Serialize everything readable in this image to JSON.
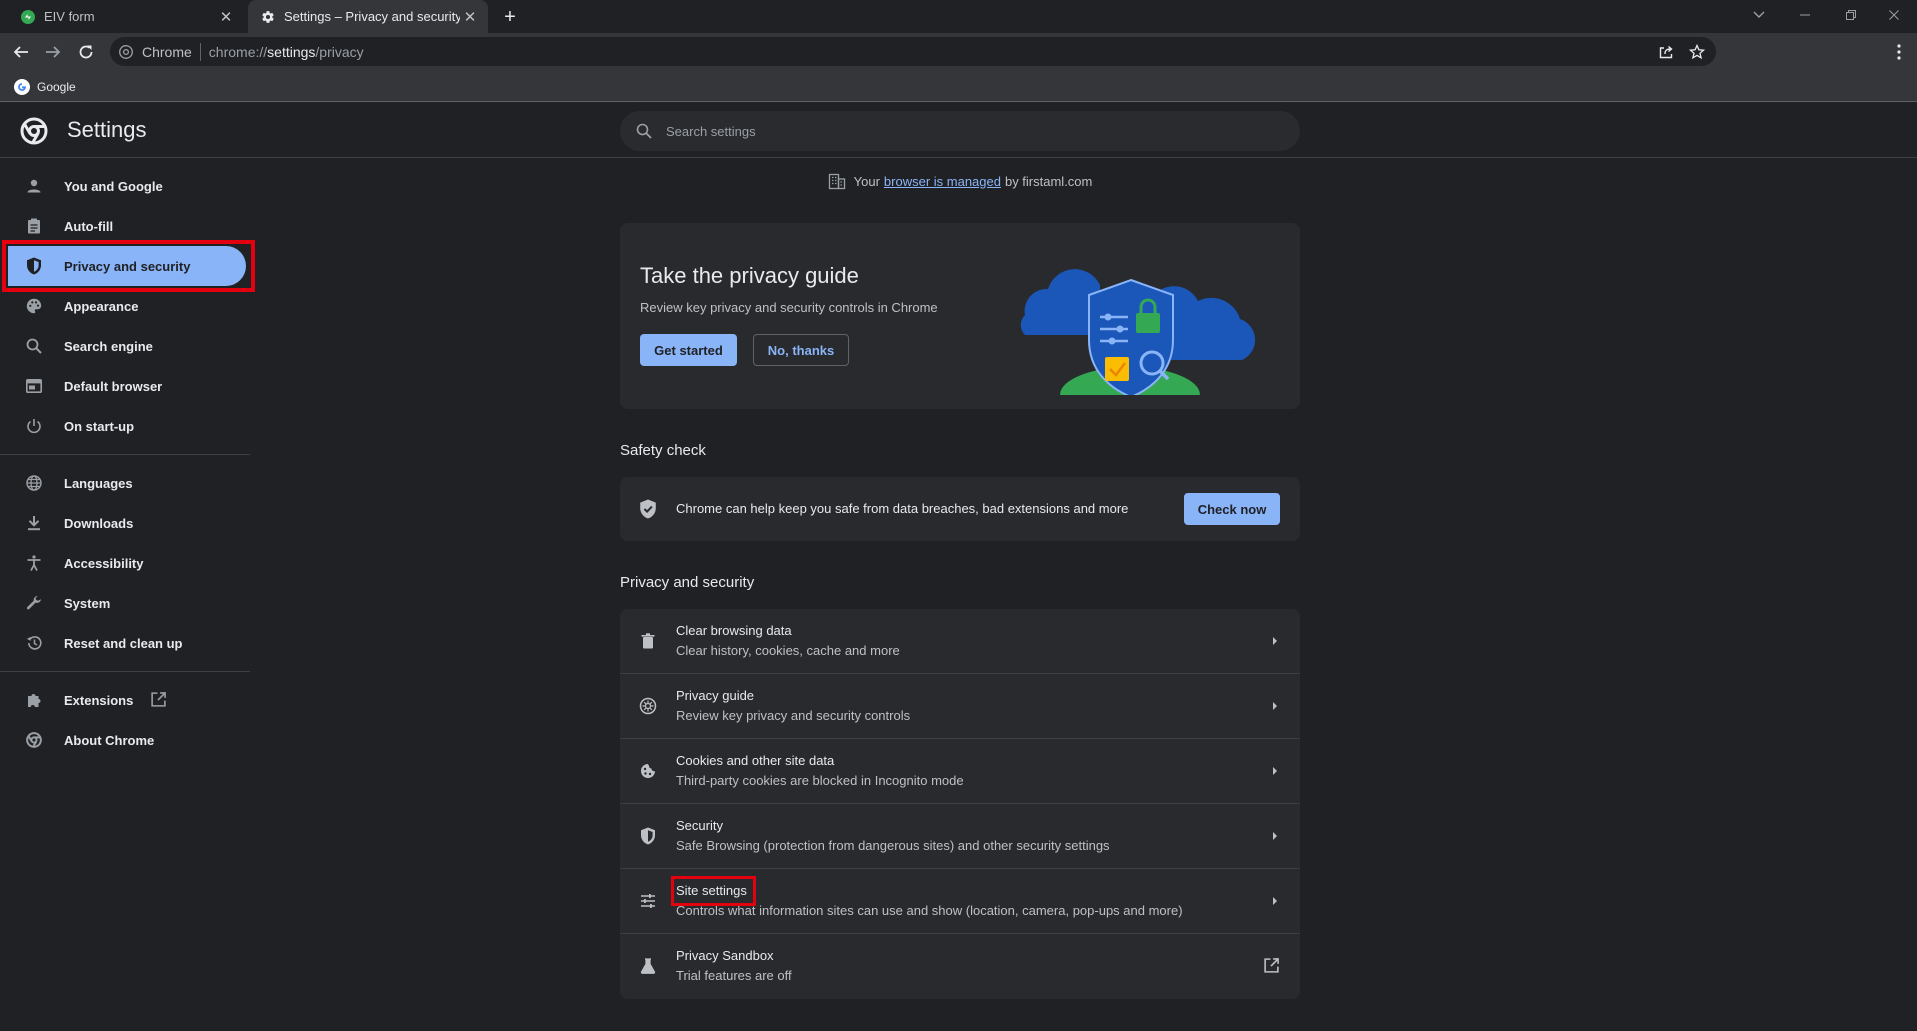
{
  "tabs": [
    {
      "title": "EIV form",
      "active": false
    },
    {
      "title": "Settings – Privacy and security",
      "active": true
    }
  ],
  "toolbar": {
    "origin": "Chrome",
    "url_scheme": "chrome://",
    "url_host": "settings",
    "url_path": "/privacy"
  },
  "bookmarks": [
    {
      "label": "Google"
    }
  ],
  "settings": {
    "title": "Settings",
    "search_placeholder": "Search settings"
  },
  "sidebar": {
    "items": [
      {
        "label": "You and Google",
        "icon": "person-icon"
      },
      {
        "label": "Auto-fill",
        "icon": "clipboard-icon"
      },
      {
        "label": "Privacy and security",
        "icon": "shield-icon",
        "active": true
      },
      {
        "label": "Appearance",
        "icon": "palette-icon"
      },
      {
        "label": "Search engine",
        "icon": "search-icon"
      },
      {
        "label": "Default browser",
        "icon": "browser-icon"
      },
      {
        "label": "On start-up",
        "icon": "power-icon"
      },
      {
        "label": "Languages",
        "icon": "globe-icon"
      },
      {
        "label": "Downloads",
        "icon": "download-icon"
      },
      {
        "label": "Accessibility",
        "icon": "accessibility-icon"
      },
      {
        "label": "System",
        "icon": "wrench-icon"
      },
      {
        "label": "Reset and clean up",
        "icon": "history-icon"
      },
      {
        "label": "Extensions",
        "icon": "puzzle-icon"
      },
      {
        "label": "About Chrome",
        "icon": "chrome-icon"
      }
    ]
  },
  "managed": {
    "prefix": "Your",
    "link": "browser is managed",
    "suffix": "by firstaml.com"
  },
  "privacy_guide": {
    "title": "Take the privacy guide",
    "subtitle": "Review key privacy and security controls in Chrome",
    "primary_label": "Get started",
    "secondary_label": "No, thanks"
  },
  "safety_check": {
    "section_title": "Safety check",
    "text": "Chrome can help keep you safe from data breaches, bad extensions and more",
    "button_label": "Check now"
  },
  "privacy_section": {
    "section_title": "Privacy and security",
    "rows": [
      {
        "title": "Clear browsing data",
        "subtitle": "Clear history, cookies, cache and more",
        "icon": "trash-icon"
      },
      {
        "title": "Privacy guide",
        "subtitle": "Review key privacy and security controls",
        "icon": "compass-icon"
      },
      {
        "title": "Cookies and other site data",
        "subtitle": "Third-party cookies are blocked in Incognito mode",
        "icon": "cookie-icon"
      },
      {
        "title": "Security",
        "subtitle": "Safe Browsing (protection from dangerous sites) and other security settings",
        "icon": "shield-icon"
      },
      {
        "title": "Site settings",
        "subtitle": "Controls what information sites can use and show (location, camera, pop-ups and more)",
        "icon": "sliders-icon"
      },
      {
        "title": "Privacy Sandbox",
        "subtitle": "Trial features are off",
        "icon": "flask-icon"
      }
    ]
  },
  "colors": {
    "background": "#202124",
    "accent": "#8ab4f8",
    "highlight_box": "#e3000f"
  }
}
